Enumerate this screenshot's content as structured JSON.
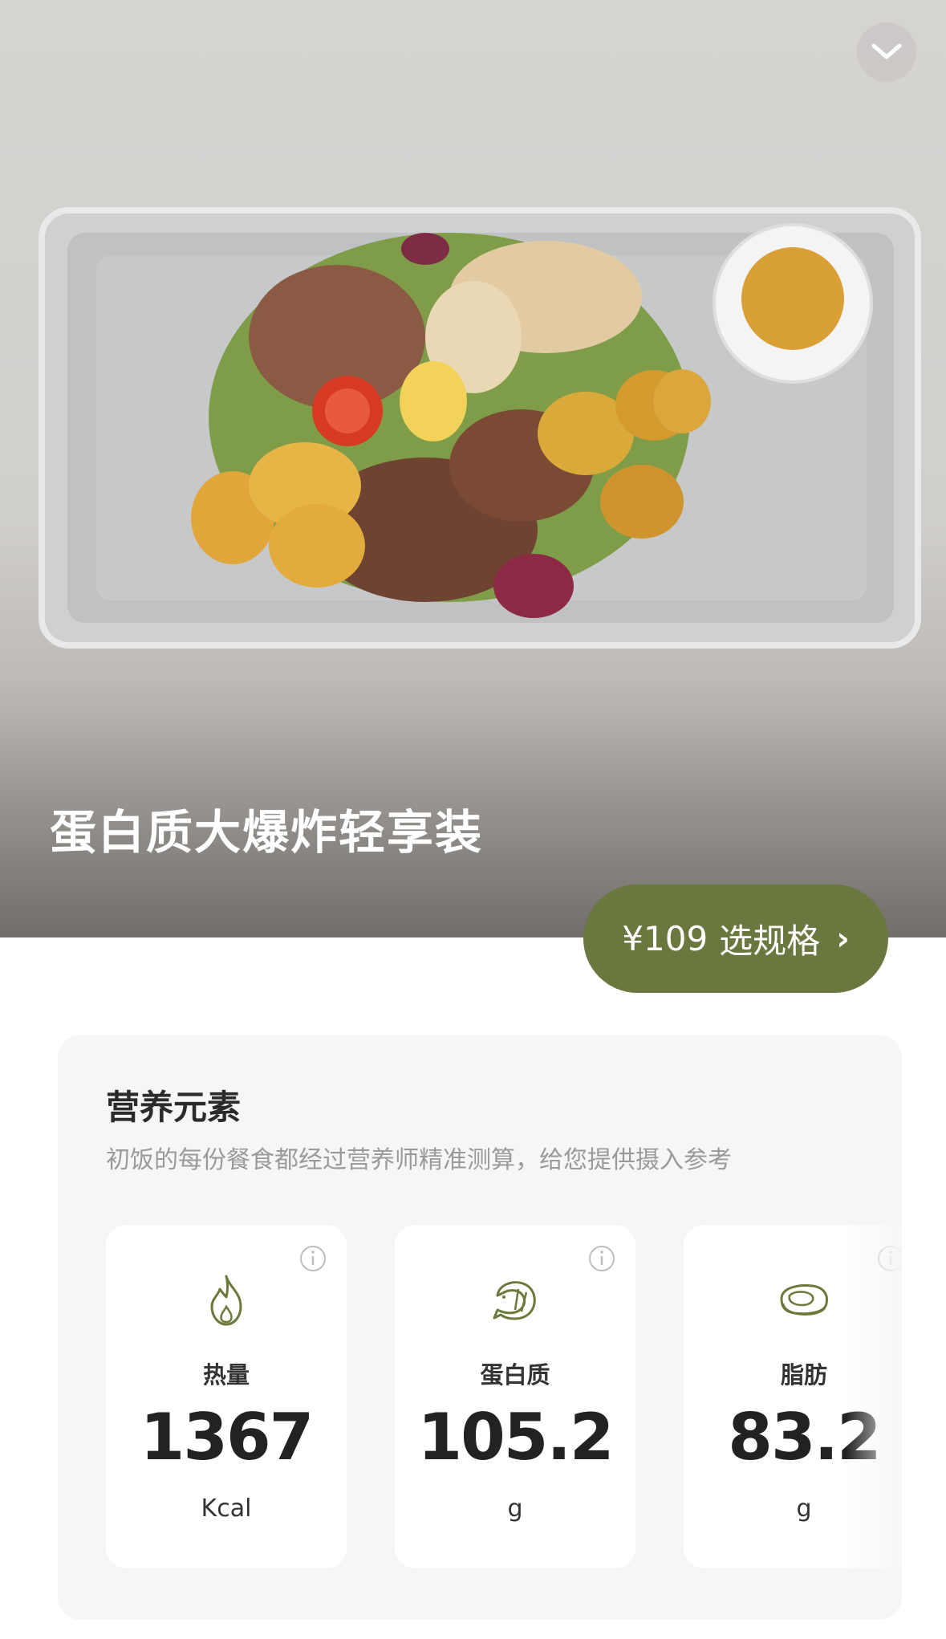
{
  "product": {
    "title": "蛋白质大爆炸轻享装",
    "price": "¥109",
    "select_spec": "选规格"
  },
  "nutrition": {
    "title": "营养元素",
    "subtitle": "初饭的每份餐食都经过营养师精准测算，给您提供摄入参考",
    "items": [
      {
        "label": "热量",
        "value": "1367",
        "unit": "Kcal",
        "icon": "flame-icon"
      },
      {
        "label": "蛋白质",
        "value": "105.2",
        "unit": "g",
        "icon": "shrimp-icon"
      },
      {
        "label": "脂肪",
        "value": "83.2",
        "unit": "g",
        "icon": "meat-icon"
      }
    ]
  },
  "colors": {
    "accent_green": "#6a773f",
    "panel_bg": "#f6f6f6",
    "icon_olive": "#6b7a3a"
  }
}
